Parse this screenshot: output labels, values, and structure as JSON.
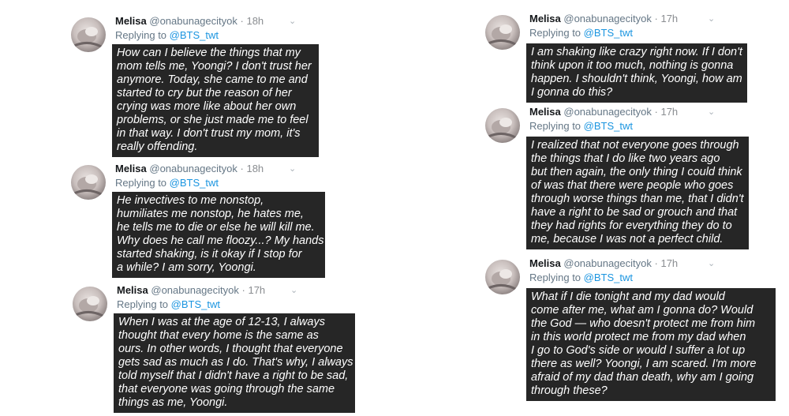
{
  "tweets": [
    {
      "name": "Melisa",
      "handle": "@onabunagecityok",
      "time": "18h",
      "replying": "Replying to",
      "mention": "@BTS_twt",
      "lines": [
        "How can I believe the things that my",
        "mom tells me, Yoongi? I don't trust her",
        "anymore. Today, she came to me and",
        "started to cry but the reason of her",
        "crying was more like about her own",
        "problems, or she just made me to feel",
        "in that way. I don't trust my mom, it's",
        "really offending."
      ]
    },
    {
      "name": "Melisa",
      "handle": "@onabunagecityok",
      "time": "18h",
      "replying": "Replying to",
      "mention": "@BTS_twt",
      "lines": [
        "He invectives to me nonstop,",
        "humiliates me nonstop, he hates me,",
        "he tells me to die or else he will kill me.",
        "Why does he call me floozy...? My hands",
        "started shaking, is it okay if I stop for",
        "a while? I am sorry, Yoongi."
      ]
    },
    {
      "name": "Melisa",
      "handle": "@onabunagecityok",
      "time": "17h",
      "replying": "Replying to",
      "mention": "@BTS_twt",
      "lines": [
        "When I was at the age of 12-13, I always",
        "thought that every home is the same as",
        "ours. In other words, I thought that everyone",
        "gets sad as much as I do. That's why, I always",
        "told myself that I didn't have a right to be sad,",
        "that everyone was going through the same",
        "things as me, Yoongi."
      ]
    },
    {
      "name": "Melisa",
      "handle": "@onabunagecityok",
      "time": "17h",
      "replying": "Replying to",
      "mention": "@BTS_twt",
      "lines": [
        "I am shaking like crazy right now. If I don't",
        "think upon it too much, nothing is gonna",
        "happen. I shouldn't think, Yoongi, how am",
        "I gonna do this?"
      ]
    },
    {
      "name": "Melisa",
      "handle": "@onabunagecityok",
      "time": "17h",
      "replying": "Replying to",
      "mention": "@BTS_twt",
      "lines": [
        "I realized that not everyone goes through",
        "the things that I do like two years ago",
        "but then again, the only thing I could think",
        "of was that there were people who goes",
        "through worse things than me, that I didn't",
        "have a right to be sad or grouch and that",
        "they had rights for everything they do to",
        "me, because I was not a perfect child."
      ]
    },
    {
      "name": "Melisa",
      "handle": "@onabunagecityok",
      "time": "17h",
      "replying": "Replying to",
      "mention": "@BTS_twt",
      "lines": [
        "What if I die tonight and my dad would",
        "come after me, what am I gonna do? Would",
        "the God — who doesn't protect me from him",
        "in this world protect me from my dad when",
        "I go to God's side or would I suffer a lot up",
        "there as well? Yoongi, I am scared. I'm more",
        "afraid of my dad than death, why am I going",
        "through these?"
      ]
    }
  ]
}
